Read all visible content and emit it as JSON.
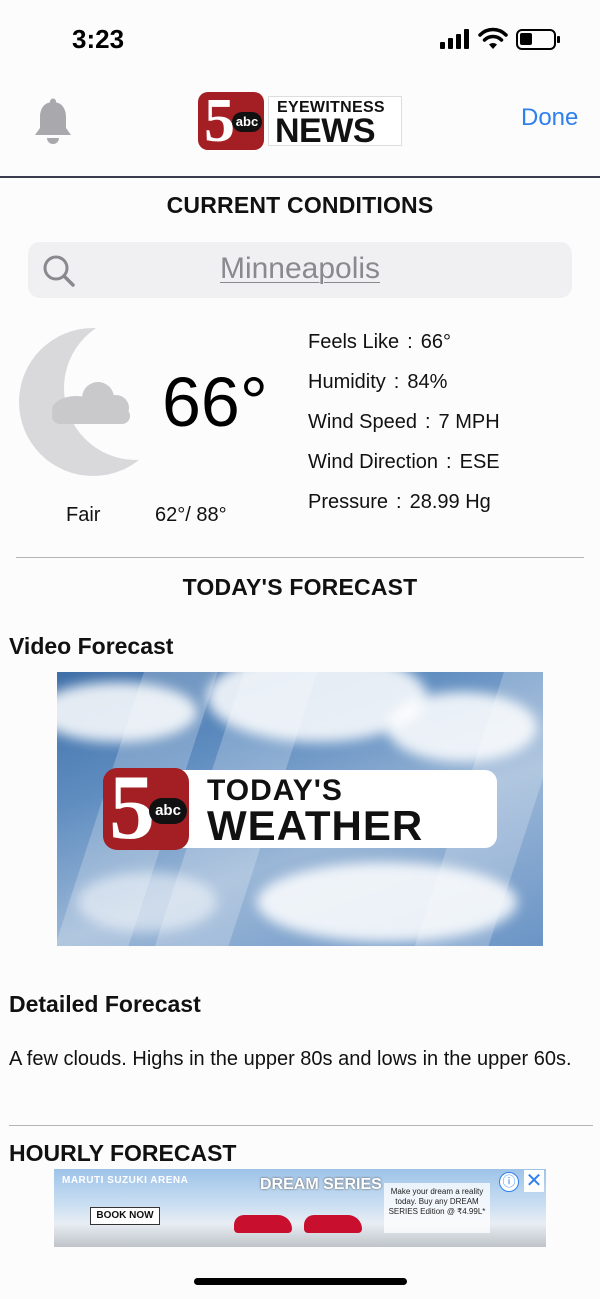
{
  "status_bar": {
    "time": "3:23",
    "battery_level": 0.4
  },
  "header": {
    "logo": {
      "number": "5",
      "network": "abc",
      "line1": "EYEWITNESS",
      "line2": "NEWS"
    },
    "done_label": "Done",
    "icons": [
      "bell-icon"
    ]
  },
  "current_conditions": {
    "title": "CURRENT CONDITIONS",
    "search_value": "Minneapolis",
    "weather_icon": "moon-cloud-icon",
    "temperature": "66°",
    "condition": "Fair",
    "hi_lo": "62°/ 88°",
    "details": [
      {
        "label": "Feels Like",
        "value": "66°"
      },
      {
        "label": "Humidity",
        "value": "84%"
      },
      {
        "label": "Wind Speed",
        "value": "7 MPH"
      },
      {
        "label": "Wind Direction",
        "value": "ESE"
      },
      {
        "label": "Pressure",
        "value": "28.99 Hg"
      }
    ]
  },
  "todays_forecast": {
    "title": "TODAY'S FORECAST",
    "video_heading": "Video Forecast",
    "video": {
      "number": "5",
      "network": "abc",
      "line1": "TODAY'S",
      "line2": "WEATHER"
    },
    "detailed_heading": "Detailed Forecast",
    "detailed_text": "A few clouds. Highs in the upper 80s and lows in the upper 60s."
  },
  "hourly_forecast": {
    "title": "HOURLY FORECAST"
  },
  "ad": {
    "brand": "MARUTI SUZUKI ARENA",
    "cta": "BOOK NOW",
    "headline": "DREAM SERIES",
    "offer": "Make your dream a reality today. Buy any DREAM SERIES Edition @ ₹4.99L*",
    "info_icon": "ⓘ",
    "close_icon": "✕"
  },
  "colors": {
    "accent_blue": "#2f80ed",
    "brand_red": "#a31f24"
  }
}
